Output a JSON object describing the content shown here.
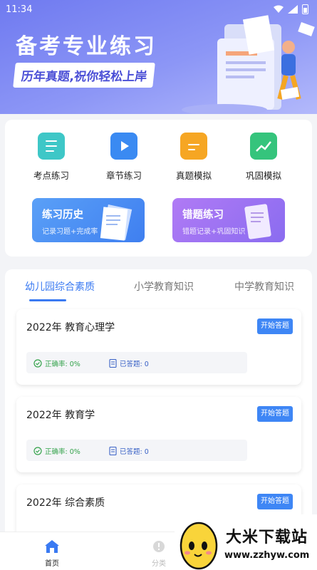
{
  "status_bar": {
    "time": "11:34"
  },
  "banner": {
    "title": "备考专业练习",
    "subtitle": "历年真题,祝你轻松上岸"
  },
  "features": [
    {
      "label": "考点练习",
      "icon": "notebook-icon",
      "color": "#3ec7c7"
    },
    {
      "label": "章节练习",
      "icon": "video-doc-icon",
      "color": "#3a8af2"
    },
    {
      "label": "真题模拟",
      "icon": "folder-icon",
      "color": "#f6a623"
    },
    {
      "label": "巩固模拟",
      "icon": "chart-icon",
      "color": "#35c47c"
    }
  ],
  "history_button": {
    "title": "练习历史",
    "subtitle": "记录习题+完成率"
  },
  "mistakes_button": {
    "title": "错题练习",
    "subtitle": "错题记录+巩固知识"
  },
  "tabs": [
    {
      "label": "幼儿园综合素质",
      "active": true
    },
    {
      "label": "小学教育知识",
      "active": false
    },
    {
      "label": "中学教育知识",
      "active": false
    }
  ],
  "papers": [
    {
      "title": "2022年 教育心理学",
      "start_label": "开始答题",
      "accuracy": "正确率: 0%",
      "answered": "已答题: 0"
    },
    {
      "title": "2022年 教育学",
      "start_label": "开始答题",
      "accuracy": "正确率: 0%",
      "answered": "已答题: 0"
    },
    {
      "title": "2022年 综合素质",
      "start_label": "开始答题"
    }
  ],
  "bottom_nav": [
    {
      "label": "首页",
      "icon": "home-icon",
      "active": true
    },
    {
      "label": "分类",
      "icon": "category-icon",
      "active": false
    }
  ],
  "watermark": {
    "name": "大米下载站",
    "url": "www.zzhyw.com"
  }
}
